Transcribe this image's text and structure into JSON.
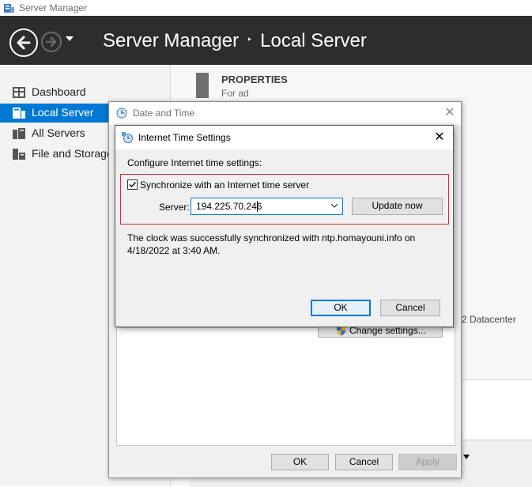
{
  "window": {
    "title": "Server Manager"
  },
  "header": {
    "breadcrumb_root": "Server Manager",
    "breadcrumb_separator": "‣",
    "breadcrumb_current": "Local Server"
  },
  "sidebar": {
    "items": [
      {
        "label": "Dashboard",
        "icon": "dashboard-icon"
      },
      {
        "label": "Local Server",
        "icon": "server-icon",
        "active": true
      },
      {
        "label": "All Servers",
        "icon": "servers-icon"
      },
      {
        "label": "File and Storage",
        "icon": "storage-icon"
      }
    ]
  },
  "content": {
    "properties_title": "PROPERTIES",
    "properties_sub": "For ad",
    "datacenter_fragment": "2 Datacenter"
  },
  "date_time_dialog": {
    "title": "Date and Time",
    "close_label": "✕",
    "change_settings_label": "Change settings...",
    "ok_label": "OK",
    "cancel_label": "Cancel",
    "apply_label": "Apply"
  },
  "internet_time_dialog": {
    "title": "Internet Time Settings",
    "close_label": "✕",
    "configure_label": "Configure Internet time settings:",
    "sync_label": "Synchronize with an Internet time server",
    "sync_checked": true,
    "server_label": "Server:",
    "server_value": "194.225.70.246",
    "update_label": "Update now",
    "status_text": "The clock was successfully synchronized with ntp.homayouni.info on 4/18/2022 at 3:40 AM.",
    "ok_label": "OK",
    "cancel_label": "Cancel"
  },
  "colors": {
    "accent": "#0078d4",
    "header_bg": "#2d2d30",
    "highlight_border": "#e0242f"
  }
}
